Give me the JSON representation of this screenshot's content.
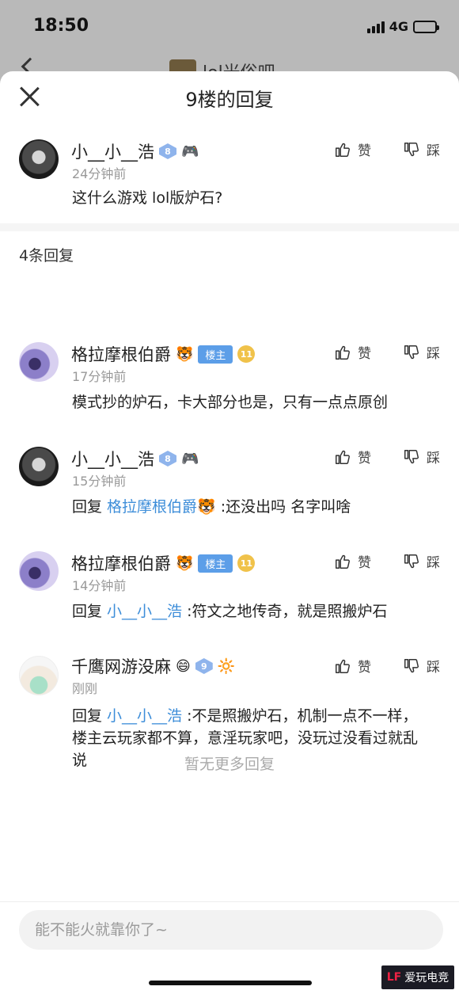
{
  "status": {
    "time": "18:50",
    "network": "4G"
  },
  "background": {
    "title": "lol光俗吧"
  },
  "sheet": {
    "title": "9楼的回复",
    "replies_count": "4条回复",
    "no_more": "暂无更多回复"
  },
  "main_comment": {
    "name": "小__小__浩",
    "level": "8",
    "time": "24分钟前",
    "text": "这什么游戏 lol版炉石?",
    "like": "赞",
    "dislike": "踩"
  },
  "replies": [
    {
      "name": "格拉摩根伯爵",
      "emoji": "🐯",
      "host_badge": "楼主",
      "level": "11",
      "time": "17分钟前",
      "text": "模式抄的炉石，卡大部分也是，只有一点点原创",
      "like": "赞",
      "dislike": "踩"
    },
    {
      "name": "小__小__浩",
      "level": "8",
      "time": "15分钟前",
      "prefix": "回复 ",
      "mention": "格拉摩根伯爵🐯",
      "text": " :还没出吗 名字叫啥",
      "like": "赞",
      "dislike": "踩"
    },
    {
      "name": "格拉摩根伯爵",
      "emoji": "🐯",
      "host_badge": "楼主",
      "level": "11",
      "time": "14分钟前",
      "prefix": "回复 ",
      "mention": "小__小__浩",
      "text": " :符文之地传奇，就是照搬炉石",
      "like": "赞",
      "dislike": "踩"
    },
    {
      "name": "千鹰网游没麻",
      "emoji": "😄",
      "level": "9",
      "time": "刚刚",
      "prefix": "回复 ",
      "mention": "小__小__浩",
      "text": " :不是照搬炉石，机制一点不一样，楼主云玩家都不算，意淫玩家吧，没玩过没看过就乱说",
      "like": "赞",
      "dislike": "踩"
    }
  ],
  "input": {
    "placeholder": "能不能火就靠你了~"
  },
  "watermark": {
    "text": "爱玩电竞"
  },
  "icons": {
    "close": "close-icon",
    "like": "thumbs-up-icon",
    "dislike": "thumbs-down-icon",
    "back": "back-arrow-icon"
  }
}
